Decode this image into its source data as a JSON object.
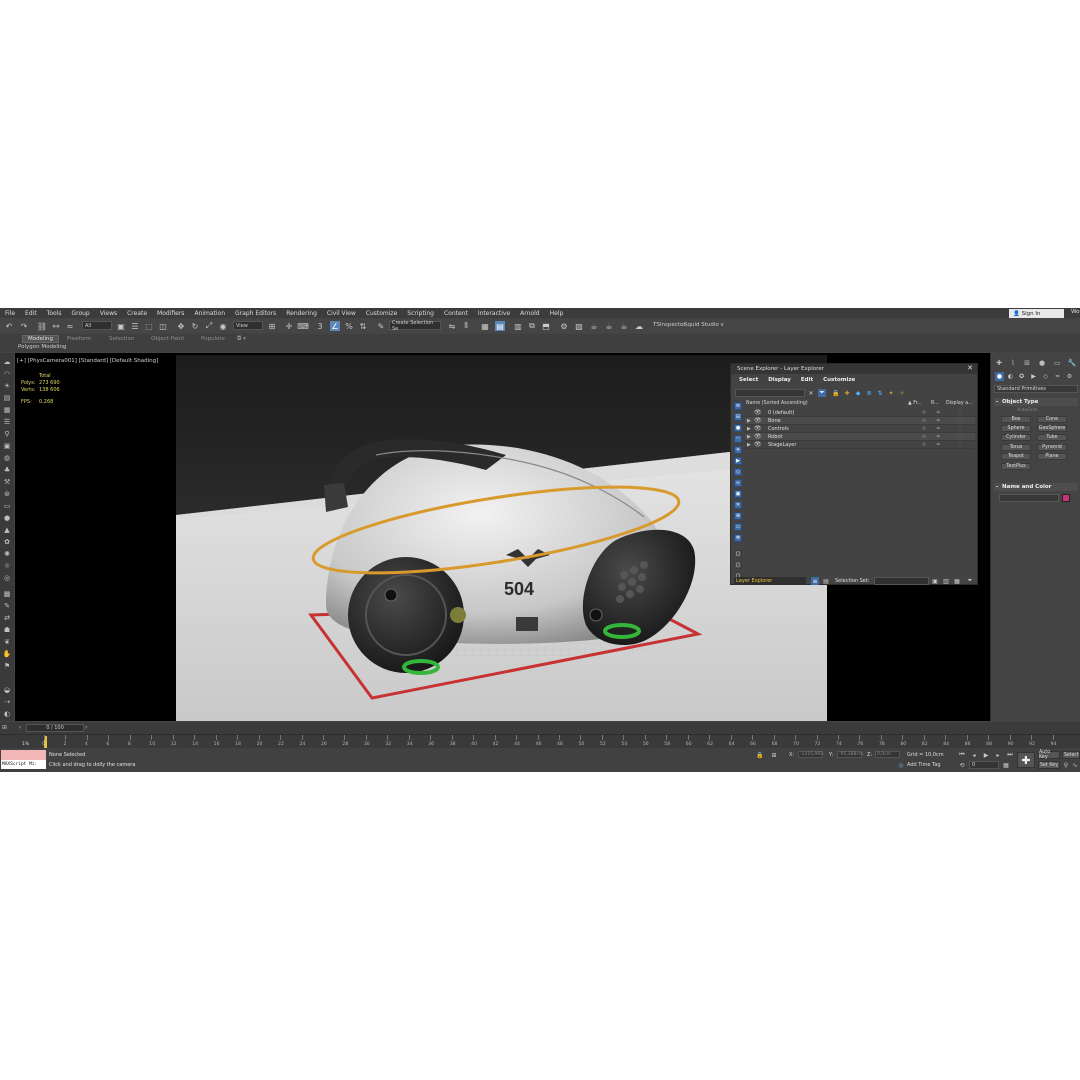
{
  "menu": [
    "File",
    "Edit",
    "Tools",
    "Group",
    "Views",
    "Create",
    "Modifiers",
    "Animation",
    "Graph Editors",
    "Rendering",
    "Civil View",
    "Customize",
    "Scripting",
    "Content",
    "Interactive",
    "Arnold",
    "Help"
  ],
  "account": {
    "sign_in": "Sign In",
    "workspace_prefix": "Wo"
  },
  "toolbar": {
    "selection_filter": "All",
    "ref_coord": "View",
    "selection_set_placeholder": "Create Selection Se",
    "plugin_1": "TSInspector",
    "plugin_2": "Squid Studio v"
  },
  "ribbon": {
    "tabs": [
      "Modeling",
      "Freeform",
      "Selection",
      "Object Paint",
      "Populate"
    ],
    "active_tab": "Modeling",
    "sub_label": "Polygon Modeling"
  },
  "viewport": {
    "label": "[+] [PhysCamera001] [Standard] [Default Shading]",
    "stats": {
      "header": "Total",
      "polys_label": "Polys:",
      "polys": "273 690",
      "verts_label": "Verts:",
      "verts": "138 606",
      "fps_label": "FPS:",
      "fps": "0,268"
    },
    "model_text": "504"
  },
  "explorer": {
    "title": "Scene Explorer - Layer Explorer",
    "menu": [
      "Select",
      "Display",
      "Edit",
      "Customize"
    ],
    "columns": {
      "name": "Name (Sorted Ascending)",
      "c1": "▲ Fr...",
      "c2": "R...",
      "c3": "Display a..."
    },
    "layers": [
      {
        "name": "0 (default)",
        "arrow": ""
      },
      {
        "name": "Bone",
        "arrow": "▶"
      },
      {
        "name": "Controls",
        "arrow": "▶"
      },
      {
        "name": "Robot",
        "arrow": "▶"
      },
      {
        "name": "StageLayer",
        "arrow": "▶"
      }
    ],
    "footer": {
      "dropdown": "Layer Explorer",
      "selection_set_label": "Selection Set:"
    }
  },
  "command_panel": {
    "dropdown": "Standard Primitives",
    "object_type_title": "Object Type",
    "autogrid": "AutoGrid",
    "primitives": [
      "Box",
      "Cone",
      "Sphere",
      "GeoSphere",
      "Cylinder",
      "Tube",
      "Torus",
      "Pyramid",
      "Teapot",
      "Plane",
      "TextPlus"
    ],
    "name_color_title": "Name and Color",
    "object_color": "#c3347a"
  },
  "timeline": {
    "slider": "0 / 100",
    "ticks": [
      "0",
      "2",
      "4",
      "6",
      "8",
      "10",
      "12",
      "14",
      "16",
      "18",
      "20",
      "22",
      "24",
      "26",
      "28",
      "30",
      "32",
      "34",
      "36",
      "38",
      "40",
      "42",
      "44",
      "46",
      "48",
      "50",
      "52",
      "54",
      "56",
      "58",
      "60",
      "62",
      "64",
      "66",
      "68",
      "70",
      "72",
      "74",
      "76",
      "78",
      "80",
      "82",
      "84",
      "86",
      "88",
      "90",
      "92",
      "94"
    ],
    "left_label": "1%"
  },
  "status": {
    "maxscript": "MAXScript Mi:",
    "line1": "None Selected",
    "line2": "Click and drag to dolly the camera",
    "x_label": "X:",
    "x_val": "-1215,969",
    "y_label": "Y:",
    "y_val": "-95,388cm",
    "z_label": "Z:",
    "z_val": "0,0cm",
    "grid": "Grid = 10,0cm",
    "add_time_tag": "Add Time Tag",
    "frame": "0",
    "auto_key": "Auto Key",
    "set_key": "Set Key",
    "selected": "Selected"
  }
}
